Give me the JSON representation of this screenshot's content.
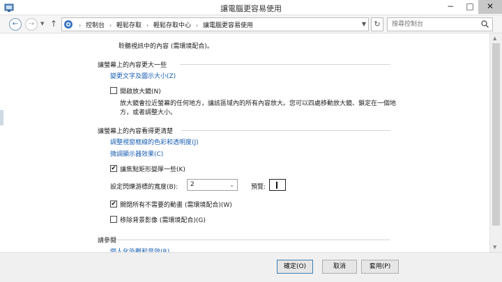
{
  "window": {
    "title": "讓電腦更容易使用",
    "minimize": "−",
    "maximize": "□",
    "close": "✕"
  },
  "navigation": {
    "breadcrumbs": [
      "控制台",
      "輕鬆存取",
      "輕鬆存取中心",
      "讓電腦更容易使用"
    ],
    "separator": "›",
    "search_placeholder": "搜尋控制台"
  },
  "content": {
    "top_line": "聆聽視訊中的內容 (需環境配合)。",
    "section_larger": {
      "heading": "讓螢幕上的內容更大一些",
      "link_text_size": "變更文字及圖示大小(Z)",
      "magnifier": {
        "label": "開啟放大鏡(N)",
        "checked": false,
        "description_line1": "放大鏡會拉近螢幕的任何地方，讓該區域內的所有內容放大。您可以四處移動放大鏡、鎖定在一個地",
        "description_line2": "方，或者調整大小。"
      }
    },
    "section_visible": {
      "heading": "讓螢幕上的內容看得更清楚",
      "link_window_colors": "調整視窗框線的色彩和透明度(J)",
      "link_display_effects": "微調顯示器效果(C)",
      "focus_rectangle": {
        "label": "讓焦點矩形變厚一些(K)",
        "checked": true
      },
      "cursor_thickness": {
        "label": "設定閃爍游標的寬度(B):",
        "selected": "2",
        "preview_label": "預覽:"
      },
      "disable_animations": {
        "label": "關閉所有不需要的動畫 (需環境配合)(W)",
        "checked": true
      },
      "remove_background": {
        "label": "移除背景影像 (需環境配合)(G)",
        "checked": false
      }
    },
    "section_see_also": {
      "heading": "請參閱",
      "link_personalize": "個人化外觀和音效(R)"
    }
  },
  "buttons": {
    "ok": "確定(O)",
    "cancel": "取消",
    "apply": "套用(P)"
  }
}
